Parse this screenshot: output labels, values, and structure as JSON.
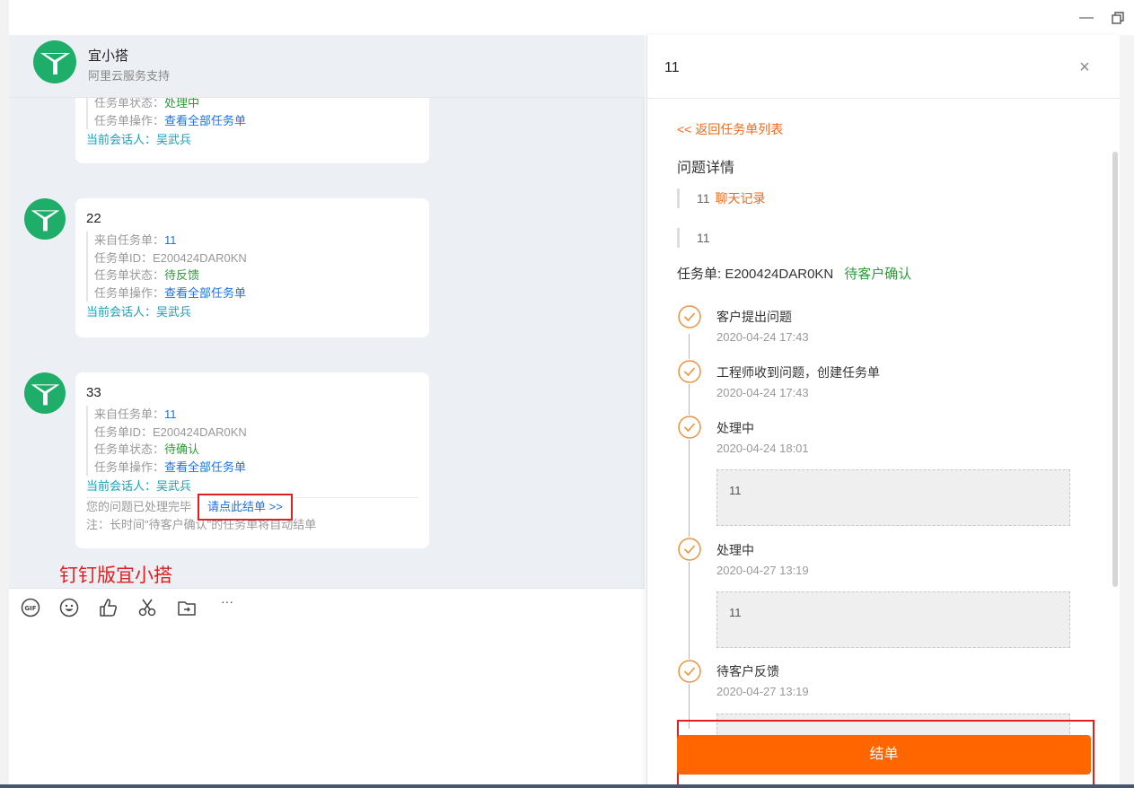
{
  "window": {
    "minimize": "—",
    "restore": "🗗"
  },
  "chat": {
    "name": "宜小搭",
    "subtitle": "阿里云服务支持",
    "messages": [
      {
        "title": "",
        "rows": [
          {
            "label": "任务单状态：",
            "value": "处理中"
          },
          {
            "label": "任务单操作：",
            "value": "查看全部任务单"
          }
        ],
        "speaker_label": "当前会话人：",
        "speaker": "吴武兵"
      },
      {
        "title": "22",
        "rows": [
          {
            "label": "来自任务单：",
            "value": "11"
          },
          {
            "label": "任务单ID：",
            "value": "E200424DAR0KN"
          },
          {
            "label": "任务单状态：",
            "value": "待反馈"
          },
          {
            "label": "任务单操作：",
            "value": "查看全部任务单"
          }
        ],
        "speaker_label": "当前会话人：",
        "speaker": "吴武兵"
      },
      {
        "title": "33",
        "rows": [
          {
            "label": "来自任务单：",
            "value": "11"
          },
          {
            "label": "任务单ID：",
            "value": "E200424DAR0KN"
          },
          {
            "label": "任务单状态：",
            "value": "待确认"
          },
          {
            "label": "任务单操作：",
            "value": "查看全部任务单"
          }
        ],
        "speaker_label": "当前会话人：",
        "speaker": "吴武兵",
        "done_text": "您的问题已处理完毕",
        "close_link": "请点此结单 >>",
        "note": "注：长时间\"待客户确认\"的任务单将自动结单"
      }
    ],
    "annotation": "钉钉版宜小搭",
    "toolbar": [
      "gif-icon",
      "emoji-icon",
      "thumbs-up-icon",
      "scissors-icon",
      "folder-icon",
      "more-icon"
    ],
    "more": "···"
  },
  "panel": {
    "title": "11",
    "close": "×",
    "back_link": "<< 返回任务单列表",
    "section_title": "问题详情",
    "quote1": "11",
    "chat_record": "聊天记录",
    "quote2": "11",
    "task_label": "任务单: E200424DAR0KN",
    "task_status": "待客户确认",
    "steps": [
      {
        "title": "客户提出问题",
        "time": "2020-04-24 17:43"
      },
      {
        "title": "工程师收到问题，创建任务单",
        "time": "2020-04-24 17:43"
      },
      {
        "title": "处理中",
        "time": "2020-04-24 18:01",
        "content": "11"
      },
      {
        "title": "处理中",
        "time": "2020-04-27 13:19",
        "content": "11"
      },
      {
        "title": "待客户反馈",
        "time": "2020-04-27 13:19"
      }
    ],
    "close_button": "结单"
  },
  "colors": {
    "accent": "#ff6600",
    "link": "#1a73e8",
    "status_green": "#2e9c3a",
    "highlight_red": "#e02020",
    "brand_green": "#1fae6a"
  }
}
